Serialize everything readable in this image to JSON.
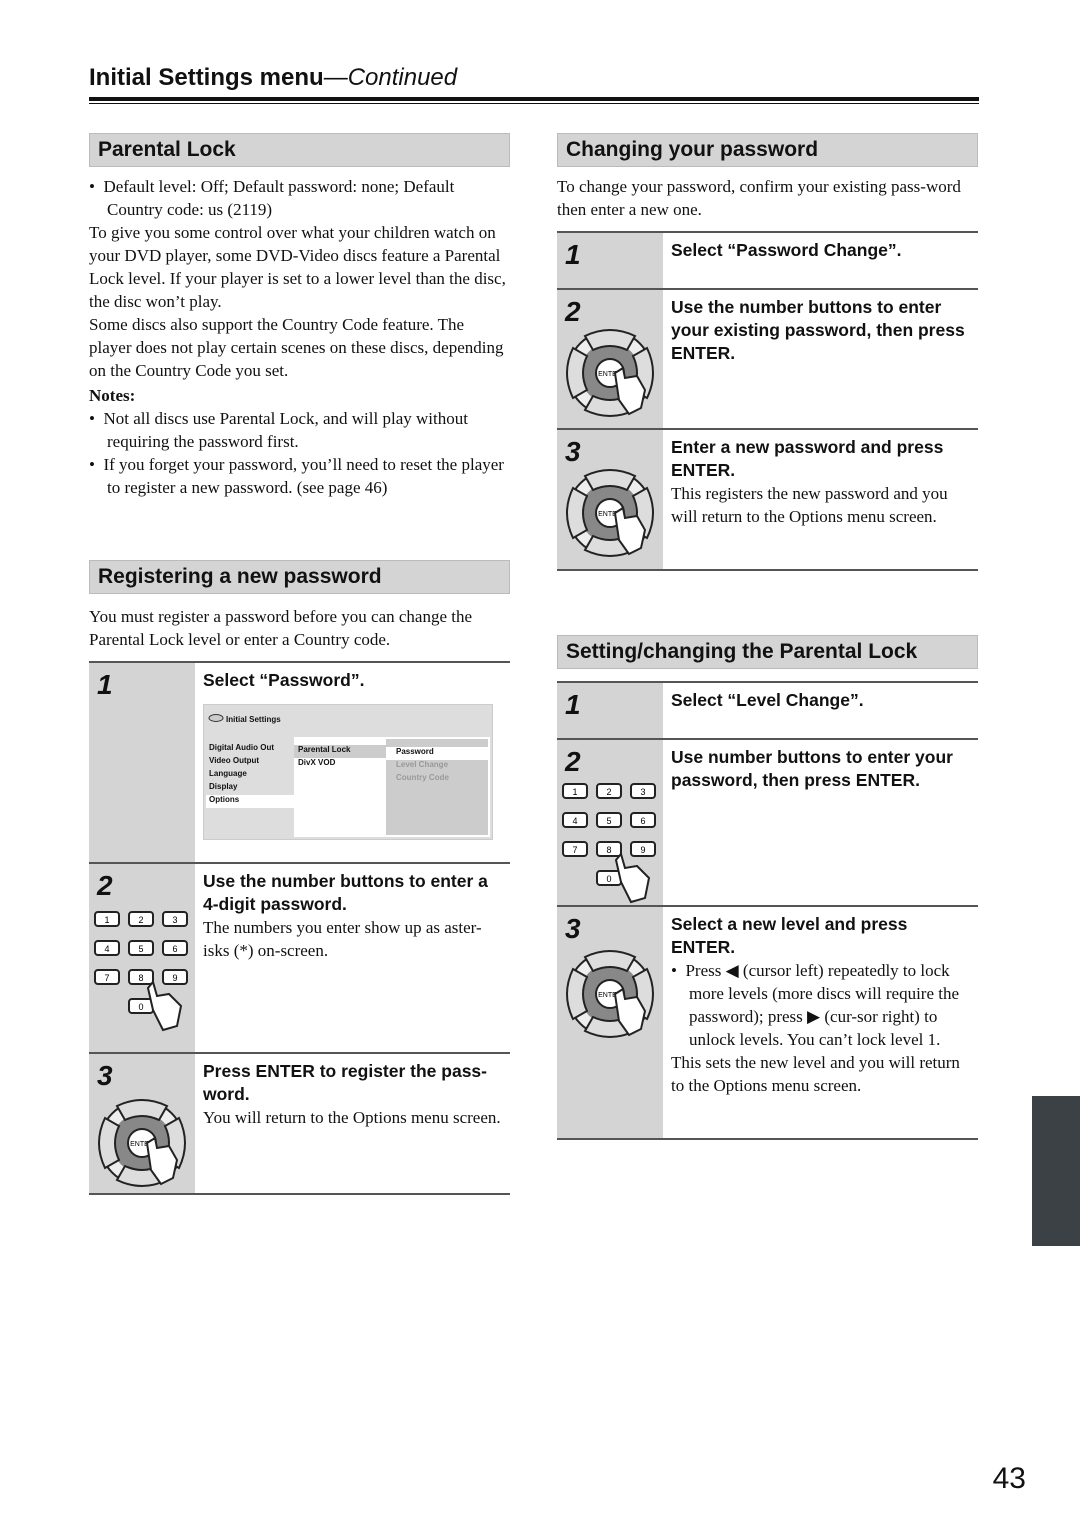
{
  "header": {
    "title": "Initial Settings menu",
    "continued": "—Continued"
  },
  "parental_lock": {
    "heading": "Parental Lock",
    "bullet": "Default level: Off; Default password: none; Default Country code: us (2119)",
    "para1": "To give you some control over what your children watch on your DVD player, some DVD-Video discs feature a Parental Lock level. If your player is set to a lower level than the disc, the disc won’t play.",
    "para2": "Some discs also support the Country Code feature. The player does not play certain scenes on these discs, depending on the Country Code you set.",
    "notes_label": "Notes:",
    "notes": [
      "Not all discs use Parental Lock, and will play without requiring the password first.",
      "If you forget your password, you’ll need to reset the player to register a new password. (see page 46)"
    ]
  },
  "register": {
    "heading": "Registering a new password",
    "intro": "You must register a password before you can change the Parental Lock level or enter a Country code.",
    "steps": [
      {
        "num": "1",
        "head": "Select “Password”.",
        "text": ""
      },
      {
        "num": "2",
        "head": "Use the number buttons to enter a 4-digit password.",
        "text": "The numbers you enter show up as aster-isks (*) on-screen."
      },
      {
        "num": "3",
        "head": "Press ENTER to register the pass-word.",
        "text": "You will return to the Options menu screen."
      }
    ],
    "menu": {
      "caption": "Initial Settings",
      "col1": [
        "Digital Audio Out",
        "Video Output",
        "Language",
        "Display",
        "Options"
      ],
      "col2": [
        "Parental Lock",
        "DivX VOD"
      ],
      "col3": [
        "Password",
        "Level Change",
        "Country Code"
      ]
    }
  },
  "change": {
    "heading": "Changing your password",
    "intro": "To change your password, confirm your existing pass-word then enter a new one.",
    "steps": [
      {
        "num": "1",
        "head": "Select “Password Change”.",
        "text": ""
      },
      {
        "num": "2",
        "head": "Use the number buttons to enter your existing password, then press ENTER.",
        "text": ""
      },
      {
        "num": "3",
        "head": "Enter a new password and press ENTER.",
        "text": "This registers the new password and you will return to the Options menu screen."
      }
    ]
  },
  "setlock": {
    "heading": "Setting/changing the Parental Lock",
    "steps": [
      {
        "num": "1",
        "head": "Select “Level Change”.",
        "text": ""
      },
      {
        "num": "2",
        "head": "Use number buttons to enter your password, then press ENTER.",
        "text": ""
      },
      {
        "num": "3",
        "head": "Select a new level and press ENTER.",
        "bullet": "Press ◀ (cursor left) repeatedly to lock more levels (more discs will require the password); press ▶ (cur-sor right) to unlock levels. You can’t lock level 1.",
        "text": "This sets the new level and you will return to the Options menu screen."
      }
    ]
  },
  "enter_label": "ENTER",
  "keys": [
    "1",
    "2",
    "3",
    "4",
    "5",
    "6",
    "7",
    "8",
    "9",
    "0"
  ],
  "page_number": "43"
}
